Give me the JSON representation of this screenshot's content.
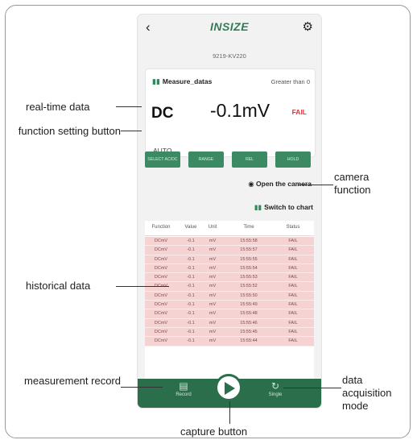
{
  "app": {
    "brand": "INSIZE",
    "device": "9219-KV220",
    "back_icon": "back-arrow-icon",
    "settings_icon": "gear-icon"
  },
  "card": {
    "title": "Measure_datas",
    "condition": "Greater than 0",
    "mode": "DC",
    "value": "-0.1mV",
    "status": "FAIL",
    "range_mode": "AUTO"
  },
  "function_buttons": [
    "SELECT AC/DC",
    "RANGE",
    "REL",
    "HOLD"
  ],
  "actions": {
    "camera": "Open the camera",
    "chart": "Switch to chart"
  },
  "table": {
    "headers": [
      "Function",
      "Value",
      "Unit",
      "Time",
      "Status"
    ],
    "rows": [
      [
        "DCmV",
        "-0.1",
        "mV",
        "15:55:58",
        "FAIL"
      ],
      [
        "DCmV",
        "-0.1",
        "mV",
        "15:55:57",
        "FAIL"
      ],
      [
        "DCmV",
        "-0.1",
        "mV",
        "15:55:55",
        "FAIL"
      ],
      [
        "DCmV",
        "-0.1",
        "mV",
        "15:55:54",
        "FAIL"
      ],
      [
        "DCmV",
        "-0.1",
        "mV",
        "15:55:53",
        "FAIL"
      ],
      [
        "DCmV",
        "-0.1",
        "mV",
        "15:55:52",
        "FAIL"
      ],
      [
        "DCmV",
        "-0.1",
        "mV",
        "15:55:50",
        "FAIL"
      ],
      [
        "DCmV",
        "-0.1",
        "mV",
        "15:55:49",
        "FAIL"
      ],
      [
        "DCmV",
        "-0.1",
        "mV",
        "15:55:48",
        "FAIL"
      ],
      [
        "DCmV",
        "-0.1",
        "mV",
        "15:55:46",
        "FAIL"
      ],
      [
        "DCmV",
        "-0.1",
        "mV",
        "15:55:45",
        "FAIL"
      ],
      [
        "DCmV",
        "-0.1",
        "mV",
        "15:55:44",
        "FAIL"
      ]
    ]
  },
  "nav": {
    "record": "Record",
    "single": "Single"
  },
  "annotations": {
    "realtime": "real-time data",
    "function_setting": "function setting button",
    "camera": "camera function",
    "historical": "historical data",
    "measurement_record": "measurement record",
    "acquisition": "data acquisition mode",
    "capture": "capture button"
  },
  "colors": {
    "brand_green": "#2f7d57",
    "nav_green": "#2b6e4c",
    "fail_red": "#d23a3a",
    "row_pink": "#f6d3d3"
  }
}
